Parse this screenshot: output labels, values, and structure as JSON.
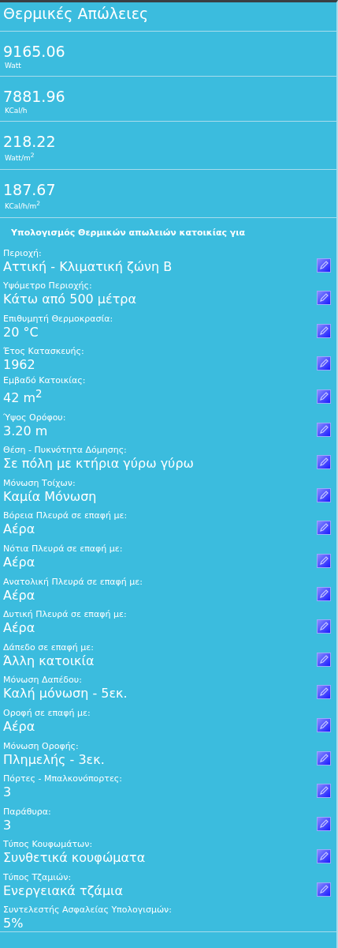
{
  "title": "Θερμικές Απώλειες",
  "results": [
    {
      "value": "9165.06",
      "unit": "Watt"
    },
    {
      "value": "7881.96",
      "unit": "KCal/h"
    },
    {
      "value": "218.22",
      "unit": "Watt/m$^{2}$"
    },
    {
      "value": "187.67",
      "unit": "KCal/h/m$^{2}$"
    }
  ],
  "section_title": "Υπολογισμός Θερμικών απωλειών κατοικίας για",
  "fields": [
    {
      "label": "Περιοχή:",
      "value": "Αττική - Κλιματική ζώνη Β",
      "editable": true
    },
    {
      "label": "Υψόμετρο Περιοχής:",
      "value": "Κάτω από 500 μέτρα",
      "editable": true
    },
    {
      "label": "Επιθυμητή Θερμοκρασία:",
      "value": "20 °C",
      "editable": true
    },
    {
      "label": "Έτος Κατασκευής:",
      "value": "1962",
      "editable": true
    },
    {
      "label": "Εμβαδό Κατοικίας:",
      "value": "42 m$^{2}$",
      "editable": true
    },
    {
      "label": "Ύψος Ορόφου:",
      "value": "3.20 m",
      "editable": true
    },
    {
      "label": "Θέση - Πυκνότητα Δόμησης:",
      "value": "Σε πόλη με κτήρια γύρω γύρω",
      "editable": true
    },
    {
      "label": "Μόνωση Τοίχων:",
      "value": "Καμία Μόνωση",
      "editable": true
    },
    {
      "label": "Βόρεια Πλευρά σε επαφή με:",
      "value": "Αέρα",
      "editable": true
    },
    {
      "label": "Νότια Πλευρά σε επαφή με:",
      "value": "Αέρα",
      "editable": true
    },
    {
      "label": "Ανατολική Πλευρά σε επαφή με:",
      "value": "Αέρα",
      "editable": true
    },
    {
      "label": "Δυτική Πλευρά σε επαφή με:",
      "value": "Αέρα",
      "editable": true
    },
    {
      "label": "Δάπεδο σε επαφή με:",
      "value": "Άλλη κατοικία",
      "editable": true
    },
    {
      "label": "Μόνωση Δαπέδου:",
      "value": "Καλή μόνωση - 5εκ.",
      "editable": true
    },
    {
      "label": "Οροφή σε επαφή με:",
      "value": "Αέρα",
      "editable": true
    },
    {
      "label": "Μόνωση Οροφής:",
      "value": "Πλημελής - 3εκ.",
      "editable": true
    },
    {
      "label": "Πόρτες - Μπαλκονόπορτες:",
      "value": "3",
      "editable": true
    },
    {
      "label": "Παράθυρα:",
      "value": "3",
      "editable": true
    },
    {
      "label": "Τύπος Κουφωμάτων:",
      "value": "Συνθετικά κουφώματα",
      "editable": true
    },
    {
      "label": "Τύπος Τζαμιών:",
      "value": "Ενεργειακά τζάμια",
      "editable": true
    },
    {
      "label": "Συντελεστής Ασφαλείας Υπολογισμών:",
      "value": "5%",
      "editable": false
    }
  ]
}
